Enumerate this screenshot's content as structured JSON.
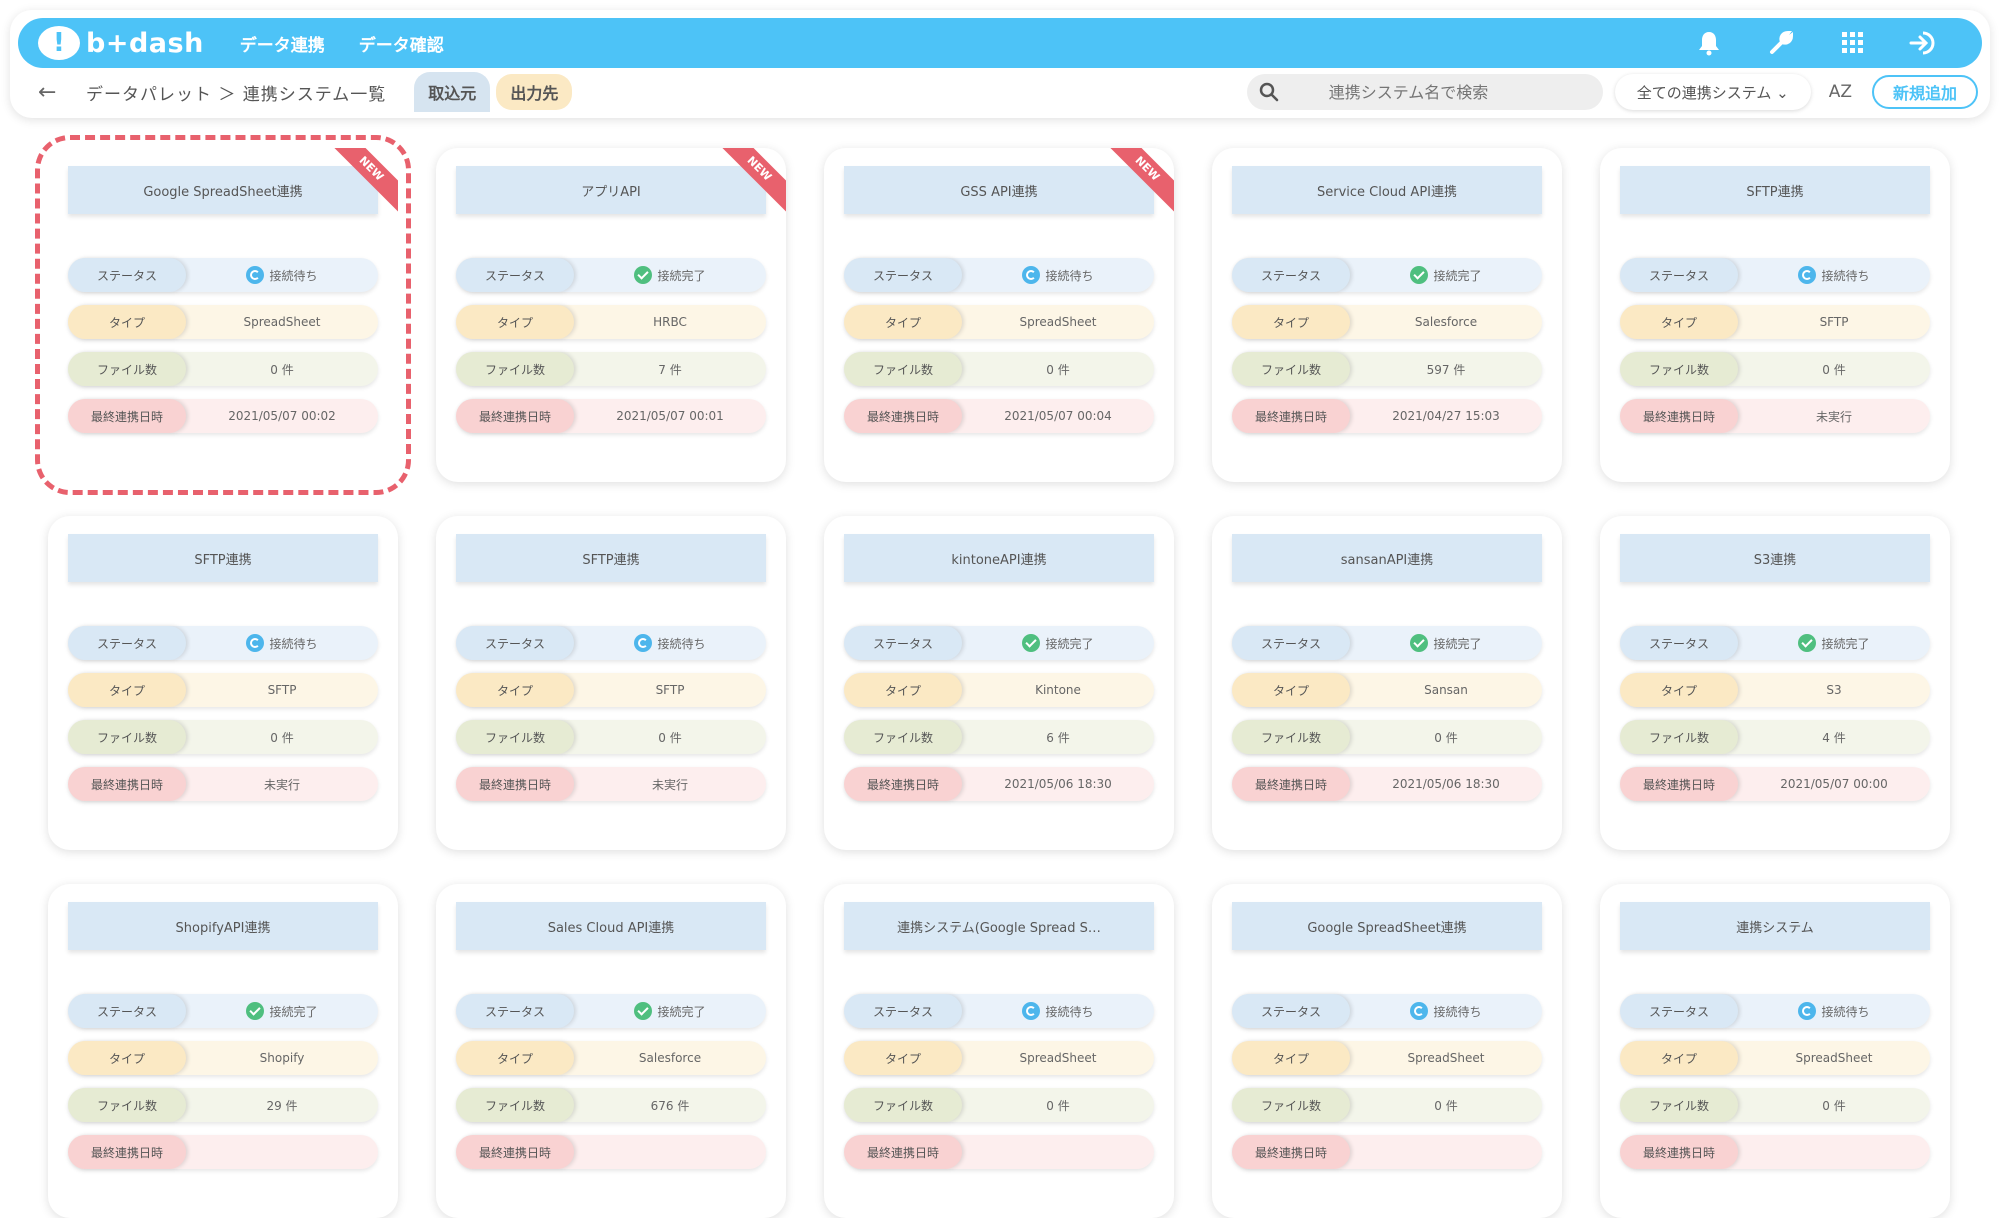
{
  "header": {
    "logo_text": "b+dash",
    "nav": [
      "データ連携",
      "データ確認"
    ],
    "icons": [
      "bell-icon",
      "wrench-icon",
      "grid-menu-icon",
      "logout-icon"
    ]
  },
  "subbar": {
    "back_label": "←",
    "breadcrumb": "データパレット ＞ 連携システム一覧",
    "tab_in": "取込元",
    "tab_out": "出力先",
    "search_placeholder": "連携システム名で検索",
    "filter_value": "全ての連携システム ⌄",
    "sort_label": "AZ",
    "add_label": "新規追加"
  },
  "labels": {
    "status": "ステータス",
    "type": "タイプ",
    "files": "ファイル数",
    "last": "最終連携日時",
    "new_badge": "NEW"
  },
  "colors": {
    "brand": "#4dc3f7",
    "ok": "#4fbf7f",
    "wait": "#4db6ec",
    "new": "#e8616d"
  },
  "cards": [
    {
      "title": "Google SpreadSheet連携",
      "status": "接続待ち",
      "status_kind": "wait",
      "type": "SpreadSheet",
      "files": "0 件",
      "last": "2021/05/07 00:02",
      "new": true,
      "selected": true
    },
    {
      "title": "アプリAPI",
      "status": "接続完了",
      "status_kind": "ok",
      "type": "HRBC",
      "files": "7 件",
      "last": "2021/05/07 00:01",
      "new": true
    },
    {
      "title": "GSS API連携",
      "status": "接続待ち",
      "status_kind": "wait",
      "type": "SpreadSheet",
      "files": "0 件",
      "last": "2021/05/07 00:04",
      "new": true
    },
    {
      "title": "Service Cloud API連携",
      "status": "接続完了",
      "status_kind": "ok",
      "type": "Salesforce",
      "files": "597 件",
      "last": "2021/04/27 15:03"
    },
    {
      "title": "SFTP連携",
      "status": "接続待ち",
      "status_kind": "wait",
      "type": "SFTP",
      "files": "0 件",
      "last": "未実行"
    },
    {
      "title": "SFTP連携",
      "status": "接続待ち",
      "status_kind": "wait",
      "type": "SFTP",
      "files": "0 件",
      "last": "未実行"
    },
    {
      "title": "SFTP連携",
      "status": "接続待ち",
      "status_kind": "wait",
      "type": "SFTP",
      "files": "0 件",
      "last": "未実行"
    },
    {
      "title": "kintoneAPI連携",
      "status": "接続完了",
      "status_kind": "ok",
      "type": "Kintone",
      "files": "6 件",
      "last": "2021/05/06 18:30"
    },
    {
      "title": "sansanAPI連携",
      "status": "接続完了",
      "status_kind": "ok",
      "type": "Sansan",
      "files": "0 件",
      "last": "2021/05/06 18:30"
    },
    {
      "title": "S3連携",
      "status": "接続完了",
      "status_kind": "ok",
      "type": "S3",
      "files": "4 件",
      "last": "2021/05/07 00:00"
    },
    {
      "title": "ShopifyAPI連携",
      "status": "接続完了",
      "status_kind": "ok",
      "type": "Shopify",
      "files": "29 件",
      "last": ""
    },
    {
      "title": "Sales Cloud API連携",
      "status": "接続完了",
      "status_kind": "ok",
      "type": "Salesforce",
      "files": "676 件",
      "last": ""
    },
    {
      "title": "連携システム(Google Spread S…",
      "status": "接続待ち",
      "status_kind": "wait",
      "type": "SpreadSheet",
      "files": "0 件",
      "last": ""
    },
    {
      "title": "Google SpreadSheet連携",
      "status": "接続待ち",
      "status_kind": "wait",
      "type": "SpreadSheet",
      "files": "0 件",
      "last": ""
    },
    {
      "title": "連携システム",
      "status": "接続待ち",
      "status_kind": "wait",
      "type": "SpreadSheet",
      "files": "0 件",
      "last": ""
    }
  ]
}
